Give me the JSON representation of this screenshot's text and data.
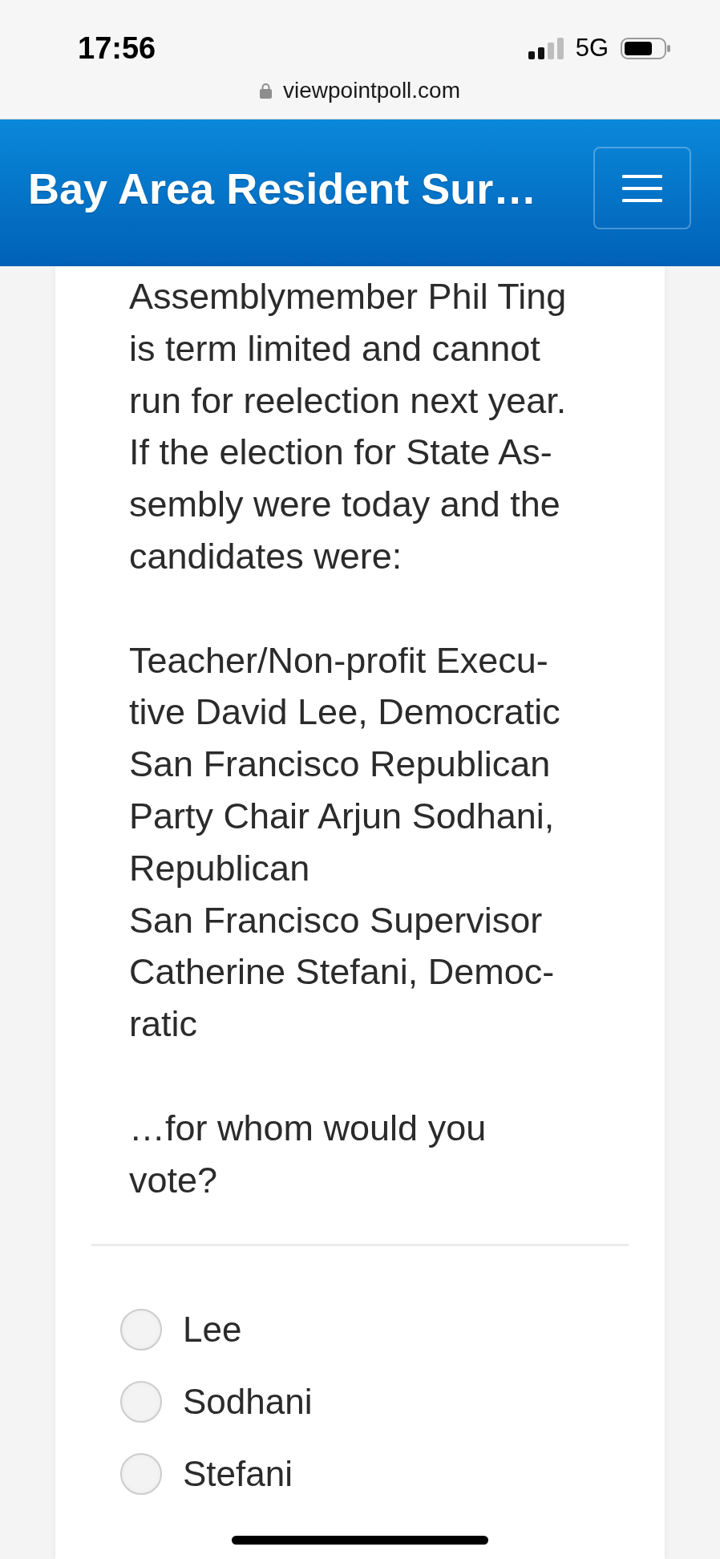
{
  "status_bar": {
    "time": "17:56",
    "network": "5G"
  },
  "browser": {
    "url": "viewpointpoll.com"
  },
  "header": {
    "title": "Bay Area Resident Sur…"
  },
  "question": {
    "intro": [
      "Assemblymember Phil Ting",
      "is term limited and cannot",
      "run for reelection next year.",
      "If the election for State As-",
      "sembly were today and the",
      "candidates were:"
    ],
    "candidates": [
      {
        "lines": [
          "Teacher/Non-profit Execu-",
          "tive David Lee, Democratic"
        ]
      },
      {
        "lines": [
          "San Francisco Republican",
          "Party Chair Arjun Sodhani,",
          "Republican"
        ]
      },
      {
        "lines": [
          "San Francisco Supervisor",
          "Catherine Stefani, Democ-",
          "ratic"
        ]
      }
    ],
    "closing": [
      "…for whom would you",
      "vote?"
    ]
  },
  "options": [
    {
      "label": "Lee",
      "selected": false
    },
    {
      "label": "Sodhani",
      "selected": false
    },
    {
      "label": "Stefani",
      "selected": false
    }
  ]
}
